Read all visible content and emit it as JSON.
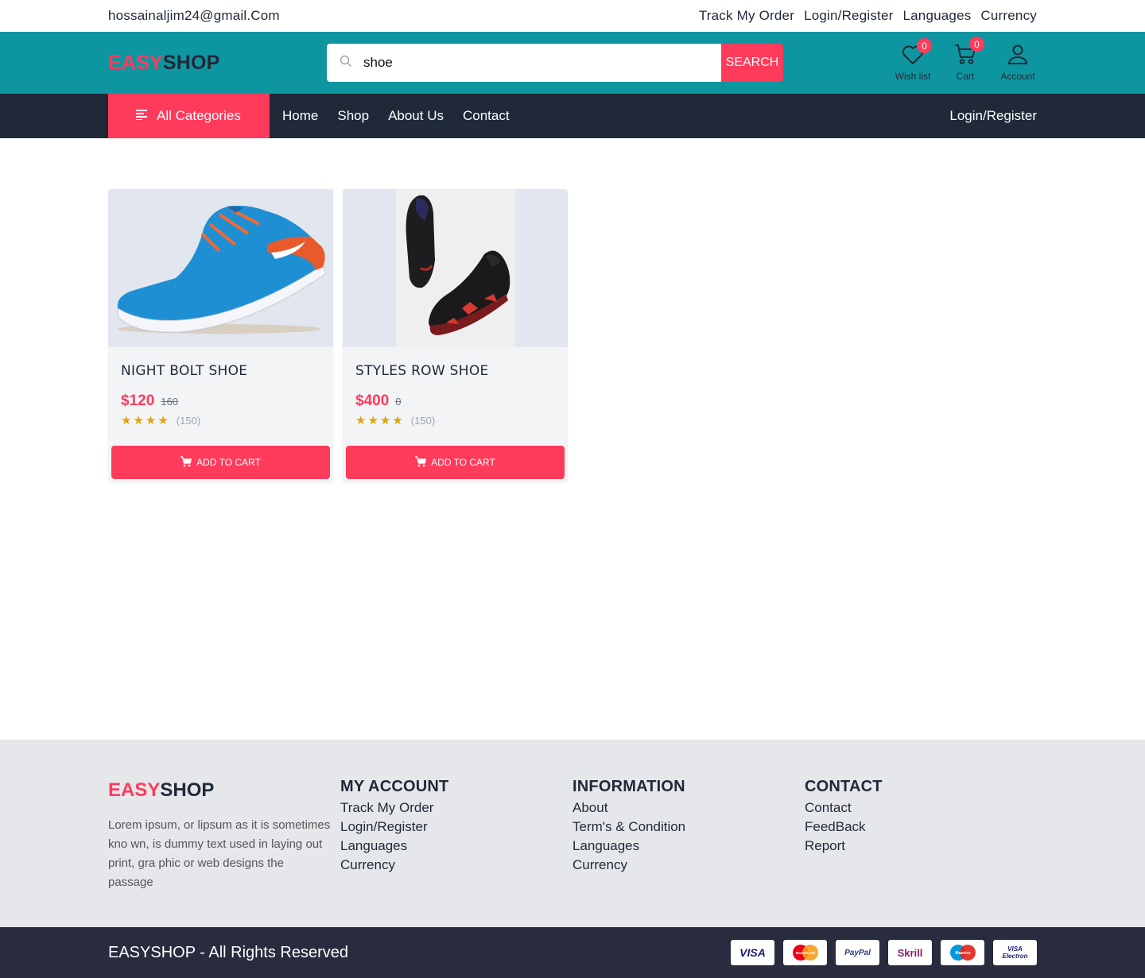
{
  "topbar": {
    "email": "hossainaljim24@gmail.Com",
    "links": [
      "Track My Order",
      "Login/Register",
      "Languages",
      "Currency"
    ]
  },
  "header": {
    "logo_a": "EASY",
    "logo_b": "SHOP",
    "search_value": "shoe",
    "search_button": "SEARCH",
    "wishlist_label": "Wish list",
    "wishlist_count": "0",
    "cart_label": "Cart",
    "cart_count": "0",
    "account_label": "Account"
  },
  "nav": {
    "categories": "All Categories",
    "menu": [
      "Home",
      "Shop",
      "About Us",
      "Contact"
    ],
    "login": "Login/Register"
  },
  "products": [
    {
      "name": "NIGHT BOLT SHOE",
      "price": "$120",
      "old_price": "160",
      "stars": "★★★★",
      "reviews": "(150)",
      "button": "ADD TO CART",
      "image": "blue-sneaker"
    },
    {
      "name": "STYLES ROW SHOE",
      "price": "$400",
      "old_price": "0",
      "stars": "★★★★",
      "reviews": "(150)",
      "button": "ADD TO CART",
      "image": "black-sneaker"
    }
  ],
  "footer": {
    "logo_a": "EASY",
    "logo_b": "SHOP",
    "description": "Lorem ipsum, or lipsum as it is sometimes kno wn, is dummy text used in laying out print, gra phic or web designs the passage",
    "columns": [
      {
        "title": "MY ACCOUNT",
        "links": [
          "Track My Order",
          "Login/Register",
          "Languages",
          "Currency"
        ]
      },
      {
        "title": "INFORMATION",
        "links": [
          "About",
          "Term's & Condition",
          "Languages",
          "Currency"
        ]
      },
      {
        "title": "CONTACT",
        "links": [
          "Contact",
          "FeedBack",
          "Report"
        ]
      }
    ],
    "copyright": "EASYSHOP - All Rights Reserved",
    "payments": [
      "VISA",
      "MasterCard",
      "PayPal",
      "Skrill",
      "Maestro",
      "VISA Electron"
    ]
  },
  "colors": {
    "accent": "#ff3b5c",
    "header": "#0e96a0",
    "nav": "#1f2937",
    "footer": "#e5e7eb",
    "bottom": "#292b3e"
  }
}
